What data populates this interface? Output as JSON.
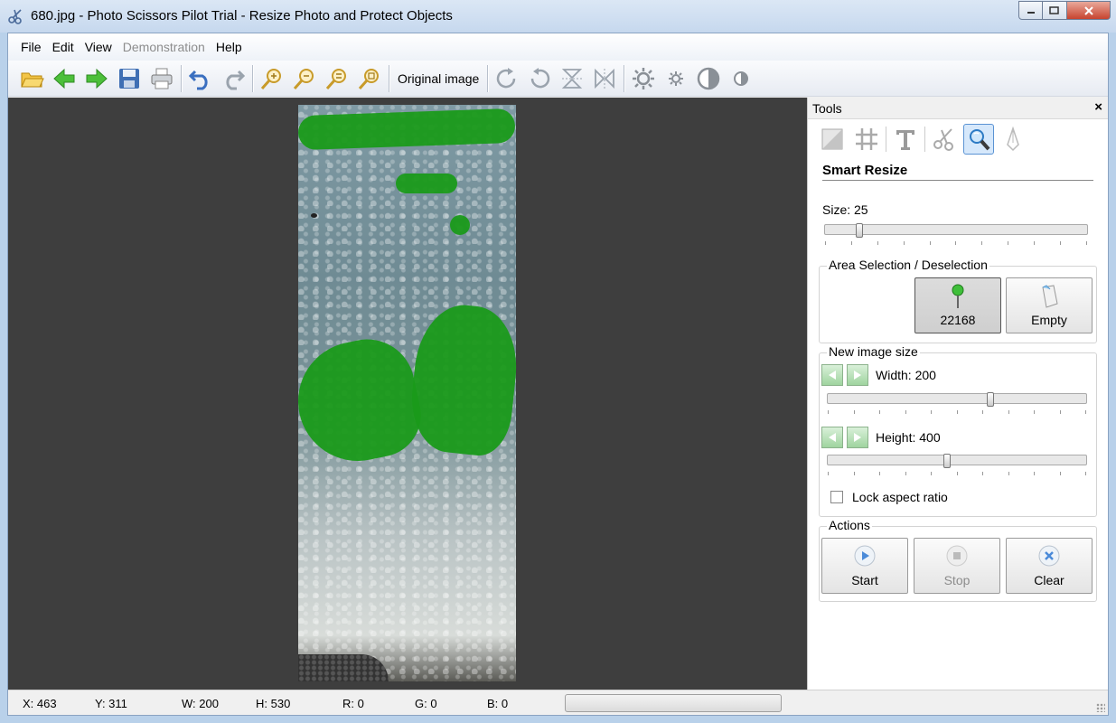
{
  "window": {
    "title": "680.jpg - Photo Scissors Pilot Trial - Resize Photo and Protect Objects"
  },
  "menu": [
    "File",
    "Edit",
    "View",
    "Demonstration",
    "Help"
  ],
  "toolbar": {
    "original_image_label": "Original image"
  },
  "tools": {
    "header": "Tools",
    "section_title": "Smart Resize",
    "size_label": "Size: 25",
    "size_value": 25,
    "area_group_title": "Area Selection / Deselection",
    "select_count": "22168",
    "empty_label": "Empty",
    "new_size_group_title": "New image size",
    "width_label": "Width: 200",
    "width_fraction": 0.62,
    "height_label": "Height: 400",
    "height_fraction": 0.45,
    "lock_label": "Lock aspect ratio",
    "lock_checked": false,
    "actions_group_title": "Actions",
    "start_label": "Start",
    "stop_label": "Stop",
    "clear_label": "Clear"
  },
  "status": {
    "x": "X: 463",
    "y": "Y: 311",
    "w": "W: 200",
    "h": "H: 530",
    "r": "R: 0",
    "g": "G: 0",
    "b": "B: 0"
  },
  "colors": {
    "mask": "#1a9a1a",
    "canvas_bg": "#3e3e3e"
  }
}
